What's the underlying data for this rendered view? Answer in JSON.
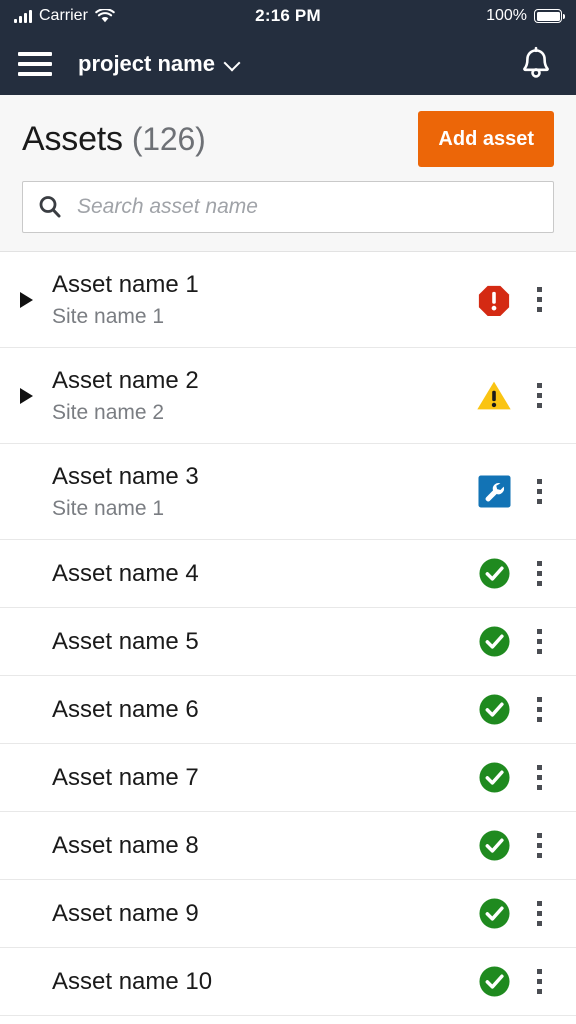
{
  "statusbar": {
    "carrier": "Carrier",
    "time": "2:16 PM",
    "battery_percent": "100%",
    "signal_icon": "signal-bars-icon",
    "wifi_icon": "wifi-icon",
    "battery_icon": "battery-full-icon"
  },
  "navbar": {
    "menu_icon": "hamburger-menu-icon",
    "project_label": "project name",
    "chevron_icon": "chevron-down-icon",
    "notifications_icon": "bell-icon",
    "background": "#242E3E"
  },
  "header": {
    "title": "Assets",
    "count": "(126)",
    "add_label": "Add asset",
    "add_color": "#EC6608",
    "search_icon": "search-icon",
    "search_value": "",
    "search_placeholder": "Search asset name"
  },
  "status_colors": {
    "critical": "#D42A13",
    "warning": "#FAC412",
    "maintenance": "#1273B5",
    "ok": "#1F8A1F"
  },
  "list": {
    "rows": [
      {
        "name": "Asset name 1",
        "site": "Site name 1",
        "status": "critical",
        "expandable": true
      },
      {
        "name": "Asset name 2",
        "site": "Site name 2",
        "status": "warning",
        "expandable": true
      },
      {
        "name": "Asset name 3",
        "site": "Site name 1",
        "status": "maintenance",
        "expandable": false
      },
      {
        "name": "Asset name 4",
        "site": "",
        "status": "ok",
        "expandable": false
      },
      {
        "name": "Asset name 5",
        "site": "",
        "status": "ok",
        "expandable": false
      },
      {
        "name": "Asset name 6",
        "site": "",
        "status": "ok",
        "expandable": false
      },
      {
        "name": "Asset name 7",
        "site": "",
        "status": "ok",
        "expandable": false
      },
      {
        "name": "Asset name 8",
        "site": "",
        "status": "ok",
        "expandable": false
      },
      {
        "name": "Asset name 9",
        "site": "",
        "status": "ok",
        "expandable": false
      },
      {
        "name": "Asset name 10",
        "site": "",
        "status": "ok",
        "expandable": false
      }
    ],
    "overflow_icon": "overflow-menu-icon",
    "expand_icon": "expand-triangle-icon"
  }
}
